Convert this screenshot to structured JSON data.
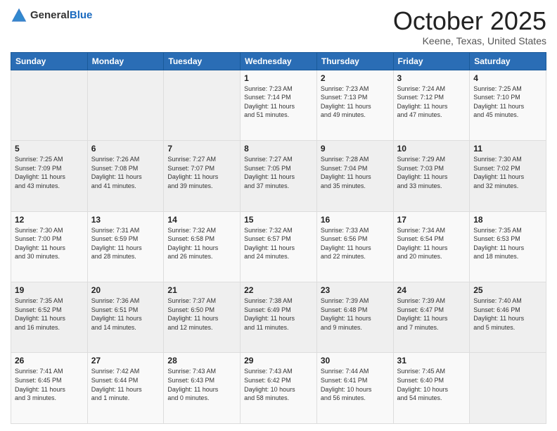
{
  "header": {
    "logo_general": "General",
    "logo_blue": "Blue",
    "month_title": "October 2025",
    "location": "Keene, Texas, United States"
  },
  "days_of_week": [
    "Sunday",
    "Monday",
    "Tuesday",
    "Wednesday",
    "Thursday",
    "Friday",
    "Saturday"
  ],
  "weeks": [
    [
      {
        "day": "",
        "info": ""
      },
      {
        "day": "",
        "info": ""
      },
      {
        "day": "",
        "info": ""
      },
      {
        "day": "1",
        "info": "Sunrise: 7:23 AM\nSunset: 7:14 PM\nDaylight: 11 hours\nand 51 minutes."
      },
      {
        "day": "2",
        "info": "Sunrise: 7:23 AM\nSunset: 7:13 PM\nDaylight: 11 hours\nand 49 minutes."
      },
      {
        "day": "3",
        "info": "Sunrise: 7:24 AM\nSunset: 7:12 PM\nDaylight: 11 hours\nand 47 minutes."
      },
      {
        "day": "4",
        "info": "Sunrise: 7:25 AM\nSunset: 7:10 PM\nDaylight: 11 hours\nand 45 minutes."
      }
    ],
    [
      {
        "day": "5",
        "info": "Sunrise: 7:25 AM\nSunset: 7:09 PM\nDaylight: 11 hours\nand 43 minutes."
      },
      {
        "day": "6",
        "info": "Sunrise: 7:26 AM\nSunset: 7:08 PM\nDaylight: 11 hours\nand 41 minutes."
      },
      {
        "day": "7",
        "info": "Sunrise: 7:27 AM\nSunset: 7:07 PM\nDaylight: 11 hours\nand 39 minutes."
      },
      {
        "day": "8",
        "info": "Sunrise: 7:27 AM\nSunset: 7:05 PM\nDaylight: 11 hours\nand 37 minutes."
      },
      {
        "day": "9",
        "info": "Sunrise: 7:28 AM\nSunset: 7:04 PM\nDaylight: 11 hours\nand 35 minutes."
      },
      {
        "day": "10",
        "info": "Sunrise: 7:29 AM\nSunset: 7:03 PM\nDaylight: 11 hours\nand 33 minutes."
      },
      {
        "day": "11",
        "info": "Sunrise: 7:30 AM\nSunset: 7:02 PM\nDaylight: 11 hours\nand 32 minutes."
      }
    ],
    [
      {
        "day": "12",
        "info": "Sunrise: 7:30 AM\nSunset: 7:00 PM\nDaylight: 11 hours\nand 30 minutes."
      },
      {
        "day": "13",
        "info": "Sunrise: 7:31 AM\nSunset: 6:59 PM\nDaylight: 11 hours\nand 28 minutes."
      },
      {
        "day": "14",
        "info": "Sunrise: 7:32 AM\nSunset: 6:58 PM\nDaylight: 11 hours\nand 26 minutes."
      },
      {
        "day": "15",
        "info": "Sunrise: 7:32 AM\nSunset: 6:57 PM\nDaylight: 11 hours\nand 24 minutes."
      },
      {
        "day": "16",
        "info": "Sunrise: 7:33 AM\nSunset: 6:56 PM\nDaylight: 11 hours\nand 22 minutes."
      },
      {
        "day": "17",
        "info": "Sunrise: 7:34 AM\nSunset: 6:54 PM\nDaylight: 11 hours\nand 20 minutes."
      },
      {
        "day": "18",
        "info": "Sunrise: 7:35 AM\nSunset: 6:53 PM\nDaylight: 11 hours\nand 18 minutes."
      }
    ],
    [
      {
        "day": "19",
        "info": "Sunrise: 7:35 AM\nSunset: 6:52 PM\nDaylight: 11 hours\nand 16 minutes."
      },
      {
        "day": "20",
        "info": "Sunrise: 7:36 AM\nSunset: 6:51 PM\nDaylight: 11 hours\nand 14 minutes."
      },
      {
        "day": "21",
        "info": "Sunrise: 7:37 AM\nSunset: 6:50 PM\nDaylight: 11 hours\nand 12 minutes."
      },
      {
        "day": "22",
        "info": "Sunrise: 7:38 AM\nSunset: 6:49 PM\nDaylight: 11 hours\nand 11 minutes."
      },
      {
        "day": "23",
        "info": "Sunrise: 7:39 AM\nSunset: 6:48 PM\nDaylight: 11 hours\nand 9 minutes."
      },
      {
        "day": "24",
        "info": "Sunrise: 7:39 AM\nSunset: 6:47 PM\nDaylight: 11 hours\nand 7 minutes."
      },
      {
        "day": "25",
        "info": "Sunrise: 7:40 AM\nSunset: 6:46 PM\nDaylight: 11 hours\nand 5 minutes."
      }
    ],
    [
      {
        "day": "26",
        "info": "Sunrise: 7:41 AM\nSunset: 6:45 PM\nDaylight: 11 hours\nand 3 minutes."
      },
      {
        "day": "27",
        "info": "Sunrise: 7:42 AM\nSunset: 6:44 PM\nDaylight: 11 hours\nand 1 minute."
      },
      {
        "day": "28",
        "info": "Sunrise: 7:43 AM\nSunset: 6:43 PM\nDaylight: 11 hours\nand 0 minutes."
      },
      {
        "day": "29",
        "info": "Sunrise: 7:43 AM\nSunset: 6:42 PM\nDaylight: 10 hours\nand 58 minutes."
      },
      {
        "day": "30",
        "info": "Sunrise: 7:44 AM\nSunset: 6:41 PM\nDaylight: 10 hours\nand 56 minutes."
      },
      {
        "day": "31",
        "info": "Sunrise: 7:45 AM\nSunset: 6:40 PM\nDaylight: 10 hours\nand 54 minutes."
      },
      {
        "day": "",
        "info": ""
      }
    ]
  ]
}
